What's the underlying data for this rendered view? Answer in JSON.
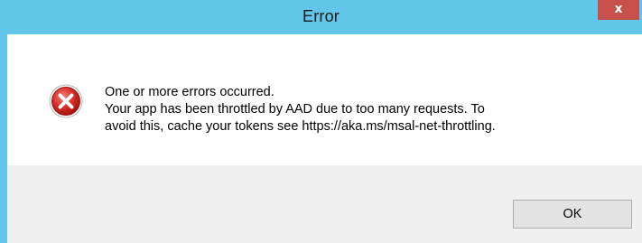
{
  "window": {
    "title": "Error",
    "close_glyph": "x"
  },
  "dialog": {
    "icon": "error-icon",
    "lines": [
      "One or more errors occurred.",
      "Your app has been throttled by AAD due to too many requests. To",
      "avoid this, cache your tokens see https://aka.ms/msal-net-throttling."
    ],
    "ok_label": "OK"
  },
  "colors": {
    "titlebar": "#62c6ea",
    "close_button": "#c7504b",
    "footer": "#f0f0f0",
    "error_red": "#cc1f1f"
  }
}
